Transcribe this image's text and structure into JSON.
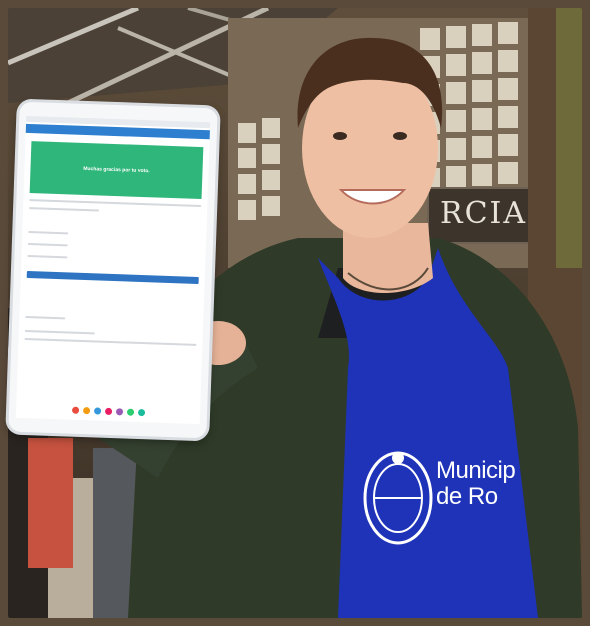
{
  "tablet": {
    "banner_text": "Muchas gracias por tu voto.",
    "dock_colors": [
      "#e74c3c",
      "#f39c12",
      "#3498db",
      "#e91e63",
      "#9b59b6",
      "#2ecc71",
      "#1abc9c"
    ]
  },
  "apron": {
    "line1": "Municip",
    "line2": "de Ro"
  },
  "sign": {
    "text": "RCIA"
  },
  "colors": {
    "apron_blue": "#1f33b8",
    "jacket": "#2f3a28",
    "banner_green": "#2fb67a",
    "button_blue": "#2e74c2"
  }
}
